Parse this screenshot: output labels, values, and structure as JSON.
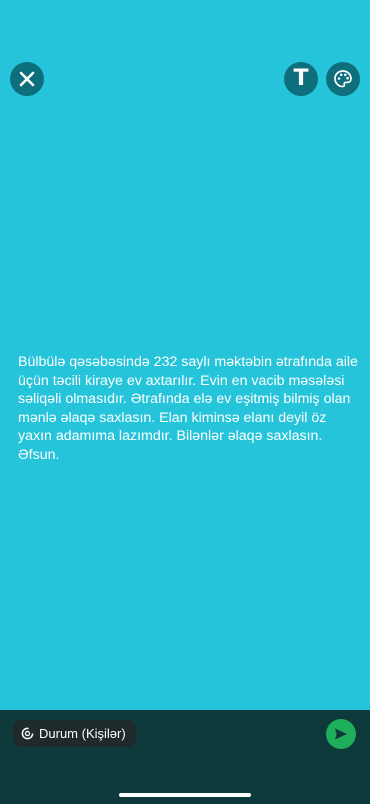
{
  "status": {
    "text": "Bülbülə qəsəbəsində 232 saylı məktəbin ətrafında aile üçün təcili kiraye ev axtarılır. Evin en vacib məsələsi səliqəli olmasıdır. Ətrafında elə ev eşitmiş bilmiş olan mənlə əlaqə saxlasın. Elan kiminsə elanı deyil öz yaxın adamıma lazımdır. Bilənlər əlaqə saxlasın.   Əfsun.",
    "background_color": "#26c4da",
    "text_color": "#ffffff"
  },
  "toolbar": {
    "close_icon": "close-icon",
    "text_tool_label": "T",
    "palette_icon": "palette-icon"
  },
  "footer": {
    "audience_label": "Durum (Kişilər)",
    "audience_icon": "status-ring-icon",
    "send_icon": "send-icon",
    "send_color": "#1fae5a"
  }
}
